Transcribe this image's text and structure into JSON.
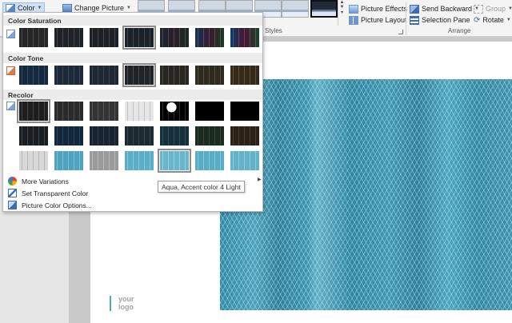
{
  "ribbon": {
    "color_label": "Color",
    "change_picture_label": "Change Picture",
    "picture_effects_label": "Picture Effects",
    "picture_layout_label": "Picture Layout",
    "send_backward_label": "Send Backward",
    "selection_pane_label": "Selection Pane",
    "group_label": "Group",
    "rotate_label": "Rotate",
    "styles_group_label": "Styles",
    "arrange_group_label": "Arrange"
  },
  "dropdown": {
    "saturation_title": "Color Saturation",
    "tone_title": "Color Tone",
    "recolor_title": "Recolor",
    "more_variations_label": "More Variations",
    "set_transparent_label": "Set Transparent Color",
    "picture_color_options_label": "Picture Color Options..."
  },
  "tooltip": "Aqua, Accent color 4 Light",
  "slide": {
    "logo_line1": "your",
    "logo_line2": "logo"
  },
  "colors": {
    "accent_aqua": "#4aa6bf",
    "ribbon_bg": "#f4f4f4",
    "selected_button_bg": "#cfe0f5"
  }
}
